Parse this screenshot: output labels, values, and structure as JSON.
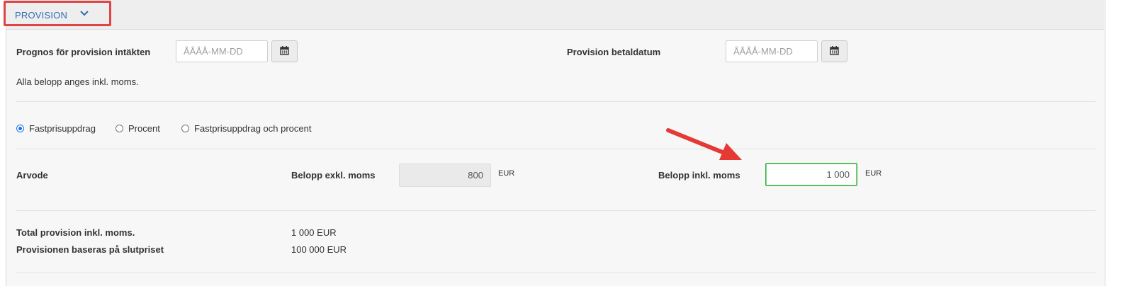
{
  "section": {
    "title": "PROVISION"
  },
  "dates": {
    "forecast_label": "Prognos för provision intäkten",
    "forecast_placeholder": "ÅÅÅÅ-MM-DD",
    "paid_label": "Provision betaldatum",
    "paid_placeholder": "ÅÅÅÅ-MM-DD"
  },
  "notice": "Alla belopp anges inkl. moms.",
  "commission_type": {
    "options": [
      "Fastprisuppdrag",
      "Procent",
      "Fastprisuppdrag och procent"
    ],
    "selected": "Fastprisuppdrag"
  },
  "fee": {
    "label": "Arvode",
    "excl_label": "Belopp exkl. moms",
    "excl_value": "800",
    "excl_unit": "EUR",
    "incl_label": "Belopp inkl. moms",
    "incl_value": "1 000",
    "incl_unit": "EUR"
  },
  "summary": [
    {
      "label": "Total provision inkl. moms.",
      "value": "1 000 EUR"
    },
    {
      "label": "Provisionen baseras på slutpriset",
      "value": "100 000 EUR"
    }
  ],
  "colors": {
    "accent": "#2d6db5",
    "highlight": "#e04545",
    "active_border": "#3cb043"
  }
}
